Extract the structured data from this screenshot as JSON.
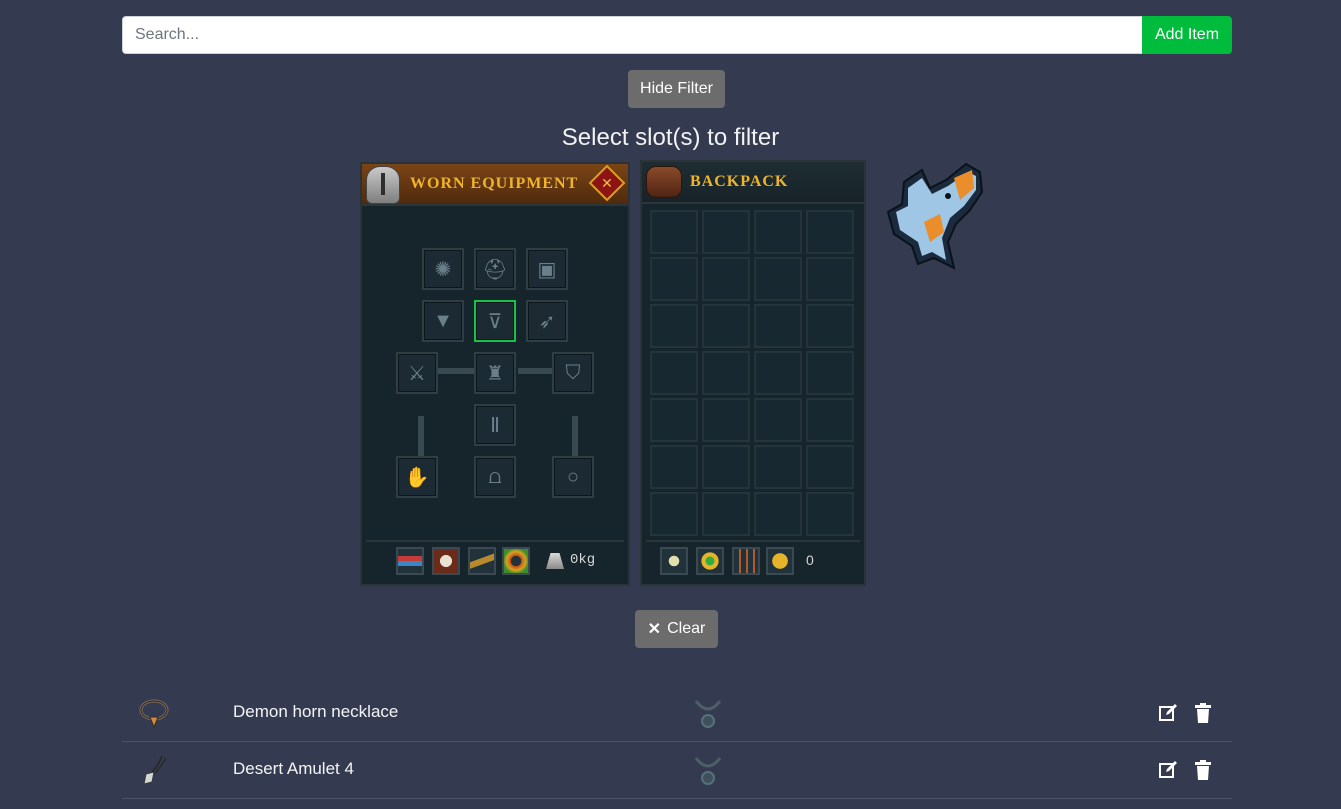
{
  "search": {
    "placeholder": "Search...",
    "value": ""
  },
  "toolbar": {
    "add_label": "Add Item",
    "hide_filter_label": "Hide Filter"
  },
  "filter": {
    "title": "Select slot(s) to filter",
    "clear_label": "Clear",
    "worn_equipment": {
      "title": "WORN EQUIPMENT",
      "weight": "0kg",
      "selected_slot": "neck",
      "slots": [
        "aura",
        "head",
        "pocket",
        "cape",
        "neck",
        "ammo",
        "weapon",
        "body",
        "shield",
        "legs",
        "hands",
        "feet",
        "ring"
      ]
    },
    "backpack": {
      "title": "BACKPACK",
      "coins": "0",
      "rows": 7,
      "cols": 4
    }
  },
  "items": [
    {
      "name": "Demon horn necklace",
      "slot": "neck"
    },
    {
      "name": "Desert Amulet 4",
      "slot": "neck"
    }
  ],
  "colors": {
    "background": "#343b50",
    "accent": "#00bc3d",
    "button_gray": "#6c6c6c",
    "selected_slot": "#19c14a"
  }
}
